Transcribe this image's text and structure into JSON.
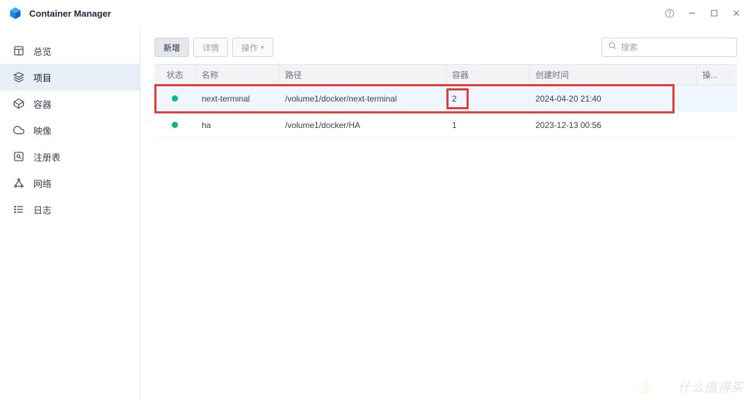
{
  "app": {
    "title": "Container Manager"
  },
  "sidebar": {
    "items": [
      {
        "label": "总览",
        "icon": "dashboard"
      },
      {
        "label": "项目",
        "icon": "layers",
        "active": true
      },
      {
        "label": "容器",
        "icon": "cube"
      },
      {
        "label": "映像",
        "icon": "cloud"
      },
      {
        "label": "注册表",
        "icon": "registry"
      },
      {
        "label": "网络",
        "icon": "network"
      },
      {
        "label": "日志",
        "icon": "list"
      }
    ]
  },
  "toolbar": {
    "add_label": "新增",
    "detail_label": "详情",
    "action_label": "操作"
  },
  "search": {
    "placeholder": "搜索"
  },
  "table": {
    "headers": {
      "status": "状态",
      "name": "名称",
      "path": "路径",
      "container": "容器",
      "created": "创建时间",
      "action": "操..."
    },
    "rows": [
      {
        "status": "running",
        "name": "next-terminal",
        "path": "/volume1/docker/next-terminal",
        "container": "2",
        "created": "2024-04-20 21:40",
        "highlighted": true,
        "selected": true
      },
      {
        "status": "running",
        "name": "ha",
        "path": "/volume1/docker/HA",
        "container": "1",
        "created": "2023-12-13 00:56"
      }
    ]
  },
  "watermark": "什么值得买"
}
